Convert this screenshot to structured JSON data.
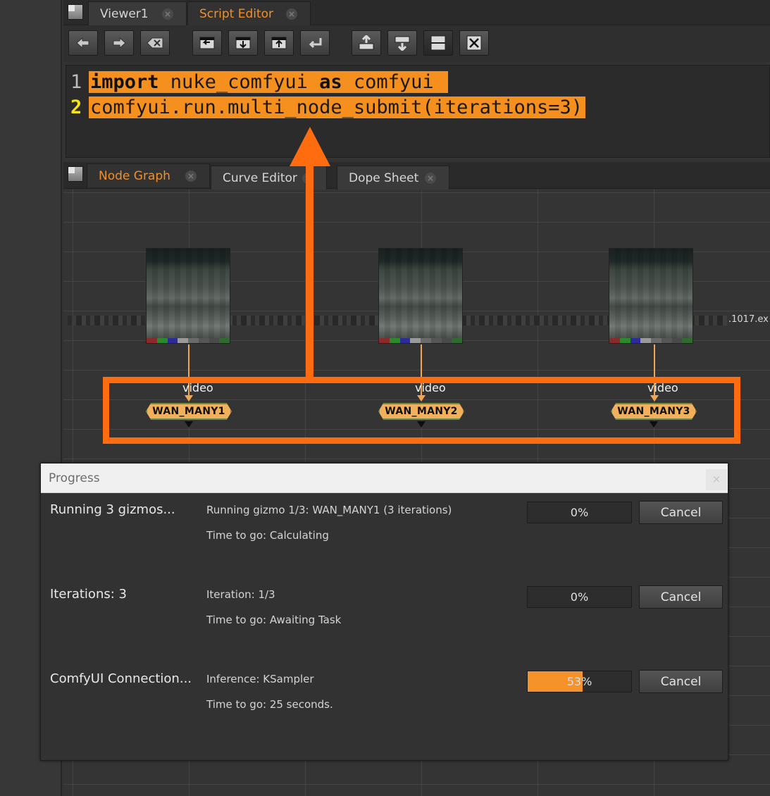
{
  "top_tabs": [
    {
      "label": "Viewer1",
      "active": false
    },
    {
      "label": "Script Editor",
      "active": true
    }
  ],
  "toolbar": {
    "buttons": [
      "previous-script-icon",
      "next-script-icon",
      "clear-history-icon",
      "source-script-icon",
      "load-script-icon",
      "save-script-icon",
      "run-script-icon",
      "show-input-icon",
      "show-output-icon",
      "split-panes-icon",
      "clear-output-icon"
    ]
  },
  "script": {
    "lines": [
      {
        "number": "1",
        "parts": [
          "import",
          " nuke_comfyui ",
          "as",
          " comfyui "
        ]
      },
      {
        "number": "2",
        "text": "comfyui.run.multi_node_submit(iterations=3)"
      }
    ]
  },
  "graph_tabs": [
    {
      "label": "Node Graph",
      "active": true
    },
    {
      "label": "Curve Editor",
      "active": false
    },
    {
      "label": "Dope Sheet",
      "active": false
    }
  ],
  "graph": {
    "read_suffix": ".1017.ex",
    "input_label": "video",
    "nodes": [
      "WAN_MANY1",
      "WAN_MANY2",
      "WAN_MANY3"
    ],
    "channel_colors": [
      "#8a2a2a",
      "#2b8a2b",
      "#2b2b9a",
      "#9a9a9a",
      "#6a6a6a",
      "#555555",
      "#4a4a4a",
      "#2f6a2f"
    ]
  },
  "progress": {
    "title": "Progress",
    "close_label": "×",
    "accent": "#f5922a",
    "rows": [
      {
        "title": "Running 3 gizmos...",
        "status": "Running gizmo 1/3: WAN_MANY1 (3 iterations)",
        "eta": "Time to go: Calculating",
        "percent": 0,
        "percent_label": "0%",
        "cancel": "Cancel"
      },
      {
        "title": "Iterations: 3",
        "status": "Iteration: 1/3",
        "eta": "Time to go: Awaiting Task",
        "percent": 0,
        "percent_label": "0%",
        "cancel": "Cancel"
      },
      {
        "title": "ComfyUI Connection...",
        "status": "Inference: KSampler",
        "eta": "Time to go: 25 seconds.",
        "percent": 53,
        "percent_label": "53%",
        "cancel": "Cancel"
      }
    ]
  }
}
